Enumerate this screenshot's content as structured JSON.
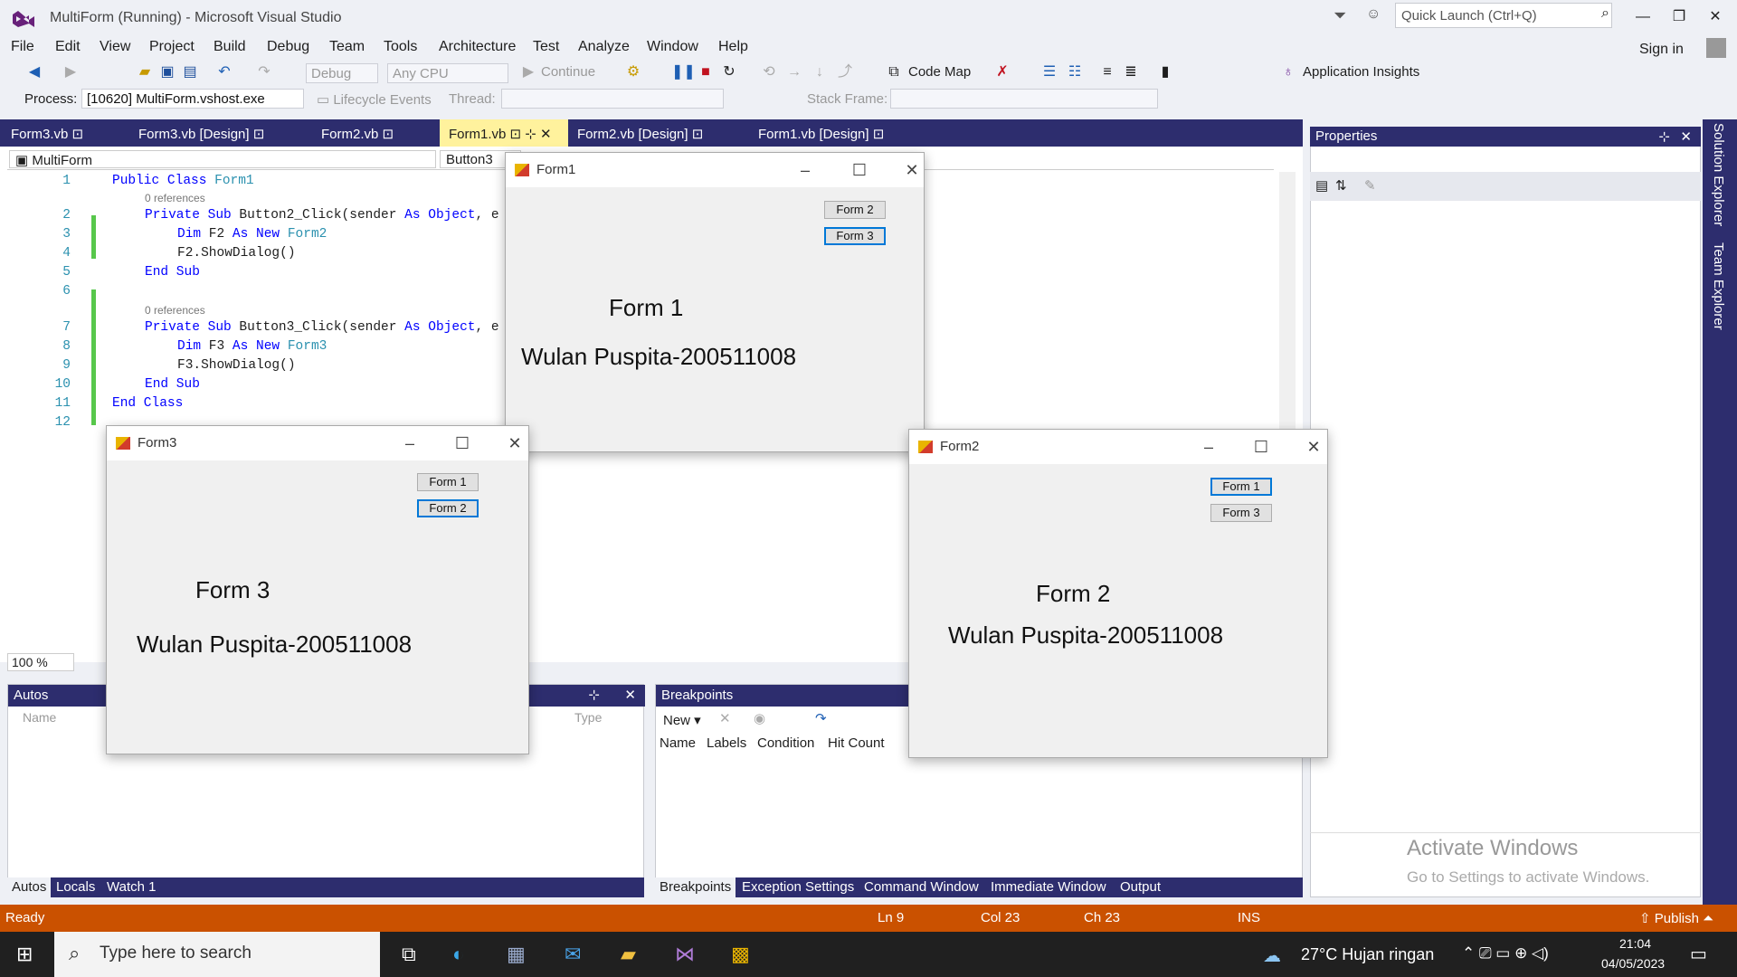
{
  "app_title": "MultiForm (Running) - Microsoft Visual Studio",
  "quick_launch_placeholder": "Quick Launch (Ctrl+Q)",
  "sign_in": "Sign in",
  "menu": [
    "File",
    "Edit",
    "View",
    "Project",
    "Build",
    "Debug",
    "Team",
    "Tools",
    "Architecture",
    "Test",
    "Analyze",
    "Window",
    "Help"
  ],
  "toolbar": {
    "config": "Debug",
    "platform": "Any CPU",
    "continue": "Continue",
    "code_map": "Code Map",
    "app_insights": "Application Insights"
  },
  "toolbar2": {
    "process_label": "Process:",
    "process_value": "[10620] MultiForm.vshost.exe",
    "lifecycle": "Lifecycle Events",
    "thread_label": "Thread:",
    "stack_frame_label": "Stack Frame:"
  },
  "tabs": [
    {
      "label": "Form3.vb"
    },
    {
      "label": "Form3.vb [Design]"
    },
    {
      "label": "Form2.vb"
    },
    {
      "label": "Form1.vb",
      "active": true
    },
    {
      "label": "Form2.vb [Design]"
    },
    {
      "label": "Form1.vb [Design]"
    }
  ],
  "nav": {
    "project": "MultiForm",
    "member": "Button3"
  },
  "code_lines": [
    {
      "n": "1",
      "text": "Public Class Form1"
    },
    {
      "refs": "0 references"
    },
    {
      "n": "2",
      "text": "Private Sub Button2_Click(sender As Object, e"
    },
    {
      "n": "3",
      "text": "Dim F2 As New Form2"
    },
    {
      "n": "4",
      "text": "F2.ShowDialog()"
    },
    {
      "n": "5",
      "text": "End Sub"
    },
    {
      "n": "6",
      "text": ""
    },
    {
      "refs": "0 references"
    },
    {
      "n": "7",
      "text": "Private Sub Button3_Click(sender As Object, e"
    },
    {
      "n": "8",
      "text": "Dim F3 As New Form3"
    },
    {
      "n": "9",
      "text": "F3.ShowDialog()"
    },
    {
      "n": "10",
      "text": "End Sub"
    },
    {
      "n": "11",
      "text": "End Class"
    },
    {
      "n": "12",
      "text": ""
    }
  ],
  "zoom": "100 %",
  "properties_title": "Properties",
  "right_vtabs": [
    "Solution Explorer",
    "Team Explorer"
  ],
  "autos": {
    "title": "Autos",
    "col_name": "Name",
    "col_type": "Type"
  },
  "bottom_tabs_left": [
    "Autos",
    "Locals",
    "Watch 1"
  ],
  "breakpoints": {
    "title": "Breakpoints",
    "new": "New",
    "cols": [
      "Name",
      "Labels",
      "Condition",
      "Hit Count"
    ]
  },
  "bottom_tabs_right": [
    "Breakpoints",
    "Exception Settings",
    "Command Window",
    "Immediate Window",
    "Output"
  ],
  "watermark": {
    "line1": "Activate Windows",
    "line2": "Go to Settings to activate Windows."
  },
  "status": {
    "ready": "Ready",
    "ln": "Ln 9",
    "col": "Col 23",
    "ch": "Ch 23",
    "ins": "INS",
    "publish": "Publish"
  },
  "taskbar": {
    "search": "Type here to search",
    "weather": "27°C  Hujan ringan",
    "time": "21:04",
    "date": "04/05/2023"
  },
  "form1": {
    "title": "Form1",
    "btn_a": "Form 2",
    "btn_b": "Form 3",
    "heading": "Form 1",
    "name": "Wulan Puspita-200511008"
  },
  "form2": {
    "title": "Form2",
    "btn_a": "Form 1",
    "btn_b": "Form 3",
    "heading": "Form 2",
    "name": "Wulan Puspita-200511008"
  },
  "form3": {
    "title": "Form3",
    "btn_a": "Form 1",
    "btn_b": "Form 2",
    "heading": "Form 3",
    "name": "Wulan Puspita-200511008"
  }
}
